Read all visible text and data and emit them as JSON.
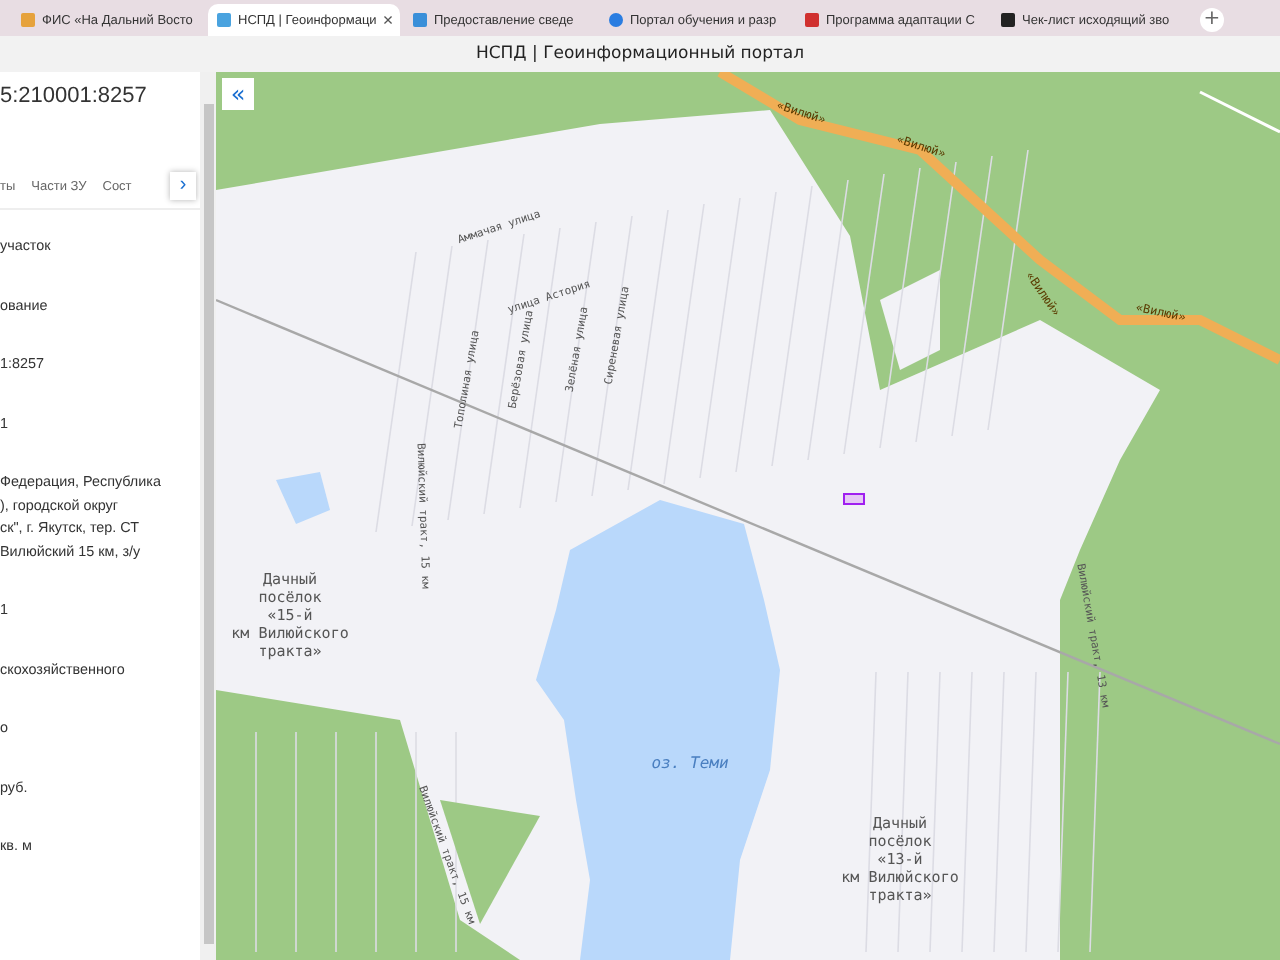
{
  "browser": {
    "tabs": [
      {
        "label": "ФИС «На Дальний Восто",
        "selected": false
      },
      {
        "label": "НСПД | Геоинформаци",
        "selected": true
      },
      {
        "label": "Предоставление сведе",
        "selected": false
      },
      {
        "label": "Портал обучения и разр",
        "selected": false
      },
      {
        "label": "Программа адаптации С",
        "selected": false
      },
      {
        "label": "Чек-лист исходящий зво",
        "selected": false
      }
    ],
    "close": "×",
    "new_tab": "+"
  },
  "window": {
    "title": "НСПД | Геоинформационный портал"
  },
  "panel": {
    "heading": "5:210001:8257",
    "tabs": [
      {
        "label": "ты",
        "selected": false
      },
      {
        "label": "Части ЗУ",
        "selected": false
      },
      {
        "label": "Сост",
        "selected": false
      }
    ],
    "next": "›",
    "rows": [
      {
        "lines": [
          "участок"
        ]
      },
      {
        "lines": [
          "ование"
        ]
      },
      {
        "lines": [
          "1:8257"
        ]
      },
      {
        "lines": [
          "1"
        ]
      },
      {
        "lines": [
          "Федерация, Республика",
          "), городской округ",
          "ск\", г. Якутск, тер. СТ",
          "Вилюйский 15 км, з/у"
        ]
      },
      {
        "lines": [
          "1"
        ]
      },
      {
        "lines": [
          "скохозяйственного"
        ]
      },
      {
        "lines": [
          "о"
        ]
      },
      {
        "lines": [
          "руб."
        ]
      },
      {
        "lines": [
          "кв. м"
        ]
      }
    ]
  },
  "map": {
    "collapse": "«",
    "labels": [
      {
        "text": "«Вилюй»",
        "kind": "road"
      },
      {
        "text": "«Вилюй»",
        "kind": "road"
      },
      {
        "text": "«Вилюй»",
        "kind": "road"
      },
      {
        "text": "«Вилюй»",
        "kind": "road"
      },
      {
        "text": "Аммачая улица",
        "kind": "street"
      },
      {
        "text": "улица Астория",
        "kind": "street"
      },
      {
        "text": "Сиреневая улица",
        "kind": "street"
      },
      {
        "text": "Зелёная улица",
        "kind": "street"
      },
      {
        "text": "Берёзовая улица",
        "kind": "street"
      },
      {
        "text": "Тополиная улица",
        "kind": "street"
      },
      {
        "text": "Вилюйский тракт, 15 км",
        "kind": "street"
      },
      {
        "text": "Вилюйский тракт, 13 км",
        "kind": "street"
      },
      {
        "text": "Вилюйский тракт, 15 км",
        "kind": "street"
      },
      {
        "text": "оз. Теми",
        "kind": "water"
      },
      {
        "text": "Дачный\nпосёлок\n«15-й\nкм Вилюйского\nтракта»",
        "kind": "settlement"
      },
      {
        "text": "Дачный\nпосёлок\n«13-й\nкм Вилюйского\nтракта»",
        "kind": "settlement"
      }
    ]
  }
}
